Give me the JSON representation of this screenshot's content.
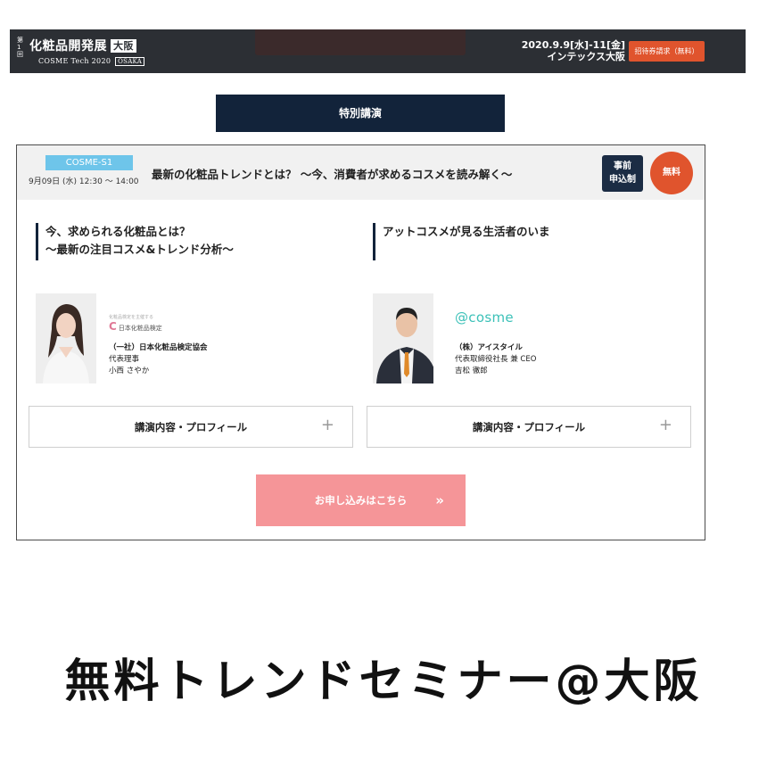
{
  "header": {
    "vertical_tag": "第1回",
    "expo_name": "化粧品開発展",
    "city_badge": "大阪",
    "sub_name": "COSME Tech 2020",
    "sub_city": "OSAKA",
    "date": "2020.9.9[水]-11[金]",
    "venue": "インテックス大阪",
    "ticket_button": "招待券請求（無料）"
  },
  "section": {
    "title": "特別講演"
  },
  "session": {
    "code": "COSME-S1",
    "datetime": "9月09日 (水) 12:30 ～ 14:00",
    "title": "最新の化粧品トレンドとは？ ～今、消費者が求めるコスメを読み解く～",
    "registration_badge": "事前申込制",
    "free_badge": "無料"
  },
  "talks": [
    {
      "title_line1": "今、求められる化粧品とは？",
      "title_line2": "～最新の注目コスメ&トレンド分析～",
      "logo_small": "日本化粧品検定",
      "logo_tagline": "化粧品検定を主催する",
      "org": "（一社）日本化粧品検定協会",
      "role": "代表理事",
      "name": "小西 さやか",
      "accordion": "講演内容・プロフィール"
    },
    {
      "title_line1": "アットコスメが見る生活者のいま",
      "title_line2": "",
      "logo_small": "@cosme",
      "org": "（株）アイスタイル",
      "role": "代表取締役社長 兼 CEO",
      "name": "吉松 徹郎",
      "accordion": "講演内容・プロフィール"
    }
  ],
  "apply_button": {
    "label": "お申し込みはこちら",
    "chevron": "»"
  },
  "caption": "無料トレンドセミナー@大阪",
  "colors": {
    "navy": "#12233a",
    "accent_orange": "#e0542d",
    "badge_blue": "#6ec5ea",
    "apply_pink": "#f59598"
  },
  "icons": [
    "plus-icon",
    "chevron-right-icon"
  ]
}
